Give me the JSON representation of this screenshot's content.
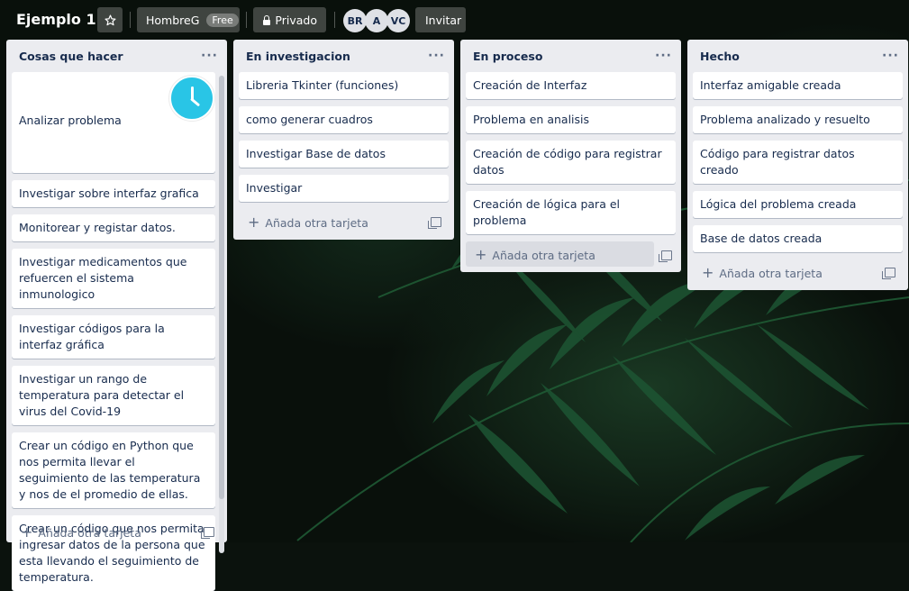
{
  "board": {
    "title": "Ejemplo 1",
    "workspace": "HombreG",
    "plan": "Free",
    "visibility": "Privado",
    "members": [
      "BR",
      "A",
      "VC"
    ],
    "invite": "Invitar"
  },
  "icons": {
    "star": "star-icon",
    "lock": "lock-icon",
    "menu": "ellipsis-icon",
    "template": "card-template-icon",
    "clock": "clock-sticker-icon"
  },
  "add_card_label": "Añada otra tarjeta",
  "lists": [
    {
      "title": "Cosas que hacer",
      "cards": [
        "Analizar problema",
        "Investigar sobre interfaz grafica",
        "Monitorear y registar datos.",
        "Investigar medicamentos que refuercen el sistema inmunologico",
        "Investigar códigos para la interfaz gráfica",
        "Investigar un rango de temperatura para detectar el virus del Covid-19",
        "Crear un código en Python que nos permita llevar el seguimiento de las temperatura y nos de el promedio de ellas.",
        "Crear un código que nos permita ingresar datos de la persona que esta llevando el seguimiento de temperatura."
      ]
    },
    {
      "title": "En investigacion",
      "cards": [
        "Libreria Tkinter (funciones)",
        "como generar cuadros",
        "Investigar Base de datos",
        "Investigar"
      ]
    },
    {
      "title": "En proceso",
      "cards": [
        "Creación de Interfaz",
        "Problema en analisis",
        "Creación de código para registrar datos",
        "Creación de lógica para el problema"
      ]
    },
    {
      "title": "Hecho",
      "cards": [
        "Interfaz amigable creada",
        "Problema analizado y resuelto",
        "Código para registrar datos creado",
        "Lógica del problema creada",
        "Base de datos creada"
      ]
    }
  ]
}
